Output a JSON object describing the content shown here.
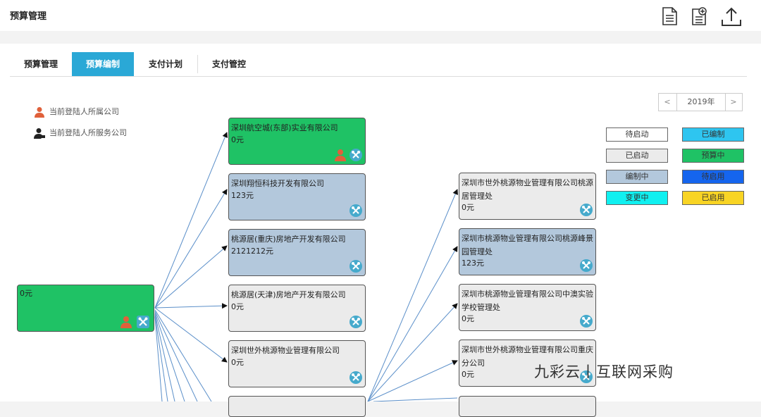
{
  "header": {
    "title": "预算管理",
    "icons": [
      "document-icon",
      "add-document-icon",
      "upload-icon"
    ]
  },
  "tabs": [
    "预算管理",
    "预算编制",
    "支付计划",
    "支付管控"
  ],
  "active_tab": 1,
  "legend": {
    "own_company": "当前登陆人所属公司",
    "service_company": "当前登陆人所服务公司"
  },
  "year": {
    "value": "2019年",
    "prev": "<",
    "next": ">"
  },
  "statuses": [
    {
      "label": "待启动",
      "color": "#ffffff"
    },
    {
      "label": "已编制",
      "color": "#2ec5f0"
    },
    {
      "label": "已启动",
      "color": "#ebebeb"
    },
    {
      "label": "预算中",
      "color": "#1fc265"
    },
    {
      "label": "编制中",
      "color": "#b3c8dc"
    },
    {
      "label": "待启用",
      "color": "#1565ee"
    },
    {
      "label": "变更中",
      "color": "#10f0f0"
    },
    {
      "label": "已启用",
      "color": "#f8d424"
    }
  ],
  "root": {
    "name": "",
    "amount": "0元"
  },
  "col1": [
    {
      "name": "深圳航空城(东部)实业有限公司",
      "amount": "0元",
      "status": "green"
    },
    {
      "name": "深圳翔恒科技开发有限公司",
      "amount": "123元",
      "status": "blue"
    },
    {
      "name": "桃源居(重庆)房地产开发有限公司",
      "amount": "2121212元",
      "status": "blue"
    },
    {
      "name": "桃源居(天津)房地产开发有限公司",
      "amount": "0元",
      "status": "gray"
    },
    {
      "name": "深圳世外桃源物业管理有限公司",
      "amount": "0元",
      "status": "gray"
    }
  ],
  "col2": [
    {
      "name": "深圳市世外桃源物业管理有限公司桃源居管理处",
      "amount": "0元",
      "status": "gray"
    },
    {
      "name": "深圳市桃源物业管理有限公司桃源峰景园管理处",
      "amount": "123元",
      "status": "blue"
    },
    {
      "name": "深圳市桃源物业管理有限公司中澳实验学校管理处",
      "amount": "0元",
      "status": "gray"
    },
    {
      "name": "深圳市世外桃源物业管理有限公司重庆分公司",
      "amount": "0元",
      "status": "gray"
    }
  ],
  "watermark": "九彩云丨互联网采购"
}
